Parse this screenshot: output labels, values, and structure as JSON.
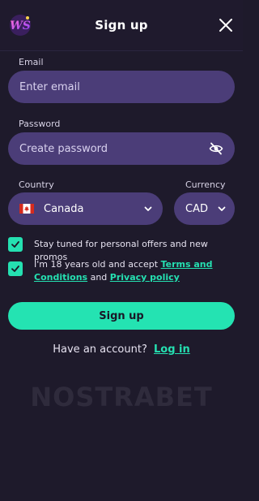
{
  "header": {
    "title": "Sign up",
    "logo_icon": "ws-logo-icon",
    "close_icon": "close-icon"
  },
  "email": {
    "label": "Email",
    "placeholder": "Enter email"
  },
  "password": {
    "label": "Password",
    "placeholder": "Create password",
    "toggle_icon": "eye-slash-icon"
  },
  "country": {
    "label": "Country",
    "selected": "Canada",
    "flag_icon": "canada-flag-icon"
  },
  "currency": {
    "label": "Currency",
    "selected": "CAD"
  },
  "consents": {
    "promos": {
      "checked": true,
      "text": "Stay tuned for personal offers and new promos"
    },
    "terms": {
      "checked": true,
      "prefix": "I'm 18 years old and accept ",
      "terms_link": "Terms and Conditions",
      "and": " and ",
      "privacy_link": "Privacy policy"
    }
  },
  "submit": {
    "label": "Sign up"
  },
  "login_prompt": {
    "text": "Have an account?",
    "link": "Log in"
  },
  "watermark": "NOSTRABET",
  "colors": {
    "background": "#1e1a2b",
    "field": "#4b3d78",
    "accent": "#25e0b1"
  }
}
